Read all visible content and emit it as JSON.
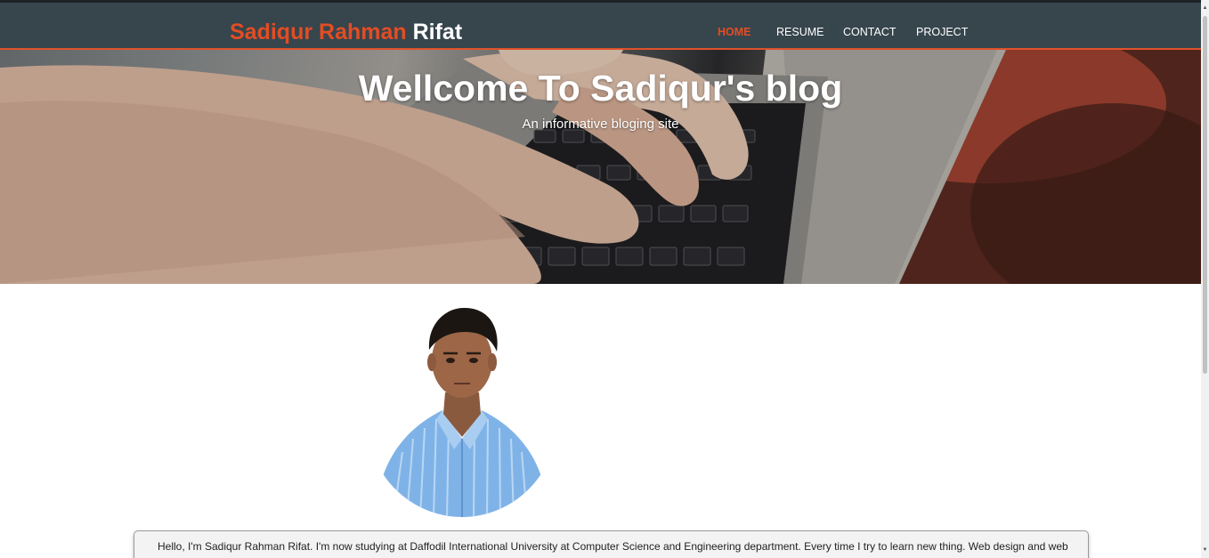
{
  "header": {
    "brand_first": "Sadiqur Rahman",
    "brand_last": "Rifat",
    "nav": {
      "home": "HOME",
      "resume": "RESUME",
      "contact": "CONTACT",
      "project": "PROJECT"
    },
    "active_item": "HOME"
  },
  "hero": {
    "title": "Wellcome To Sadiqur's blog",
    "subtitle": "An informative bloging site"
  },
  "about": {
    "text": "Hello, I'm Sadiqur Rahman Rifat. I'm now studying at Daffodil International University at Computer Science and Engineering department. Every time I try to learn new thing. Web design and web"
  },
  "colors": {
    "accent": "#e24d24",
    "navbar_bg": "#37454d"
  }
}
